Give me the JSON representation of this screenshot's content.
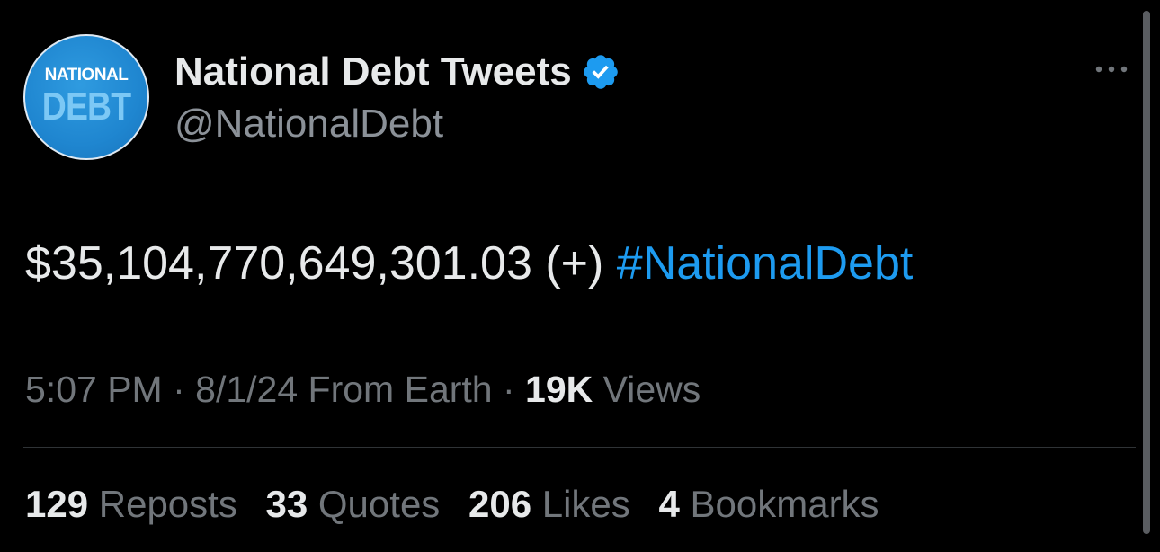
{
  "author": {
    "avatar_logo_top": "NATIONAL",
    "avatar_logo_bottom": "DEBT",
    "display_name": "National Debt Tweets",
    "handle": "@NationalDebt",
    "verified_icon": "verified-badge-icon"
  },
  "tweet": {
    "text": "$35,104,770,649,301.03 (+)",
    "hashtag": "#NationalDebt"
  },
  "meta": {
    "time": "5:07 PM",
    "separator": " · ",
    "date": "8/1/24",
    "source": "From Earth",
    "views_count": "19K",
    "views_label": "Views"
  },
  "stats": {
    "reposts": {
      "count": "129",
      "label": "Reposts"
    },
    "quotes": {
      "count": "33",
      "label": "Quotes"
    },
    "likes": {
      "count": "206",
      "label": "Likes"
    },
    "bookmarks": {
      "count": "4",
      "label": "Bookmarks"
    }
  },
  "colors": {
    "background": "#000000",
    "text_primary": "#e7e9ea",
    "text_secondary": "#71767b",
    "link": "#1d9bf0",
    "verified": "#1d9bf0",
    "avatar": "#1f86d0"
  }
}
